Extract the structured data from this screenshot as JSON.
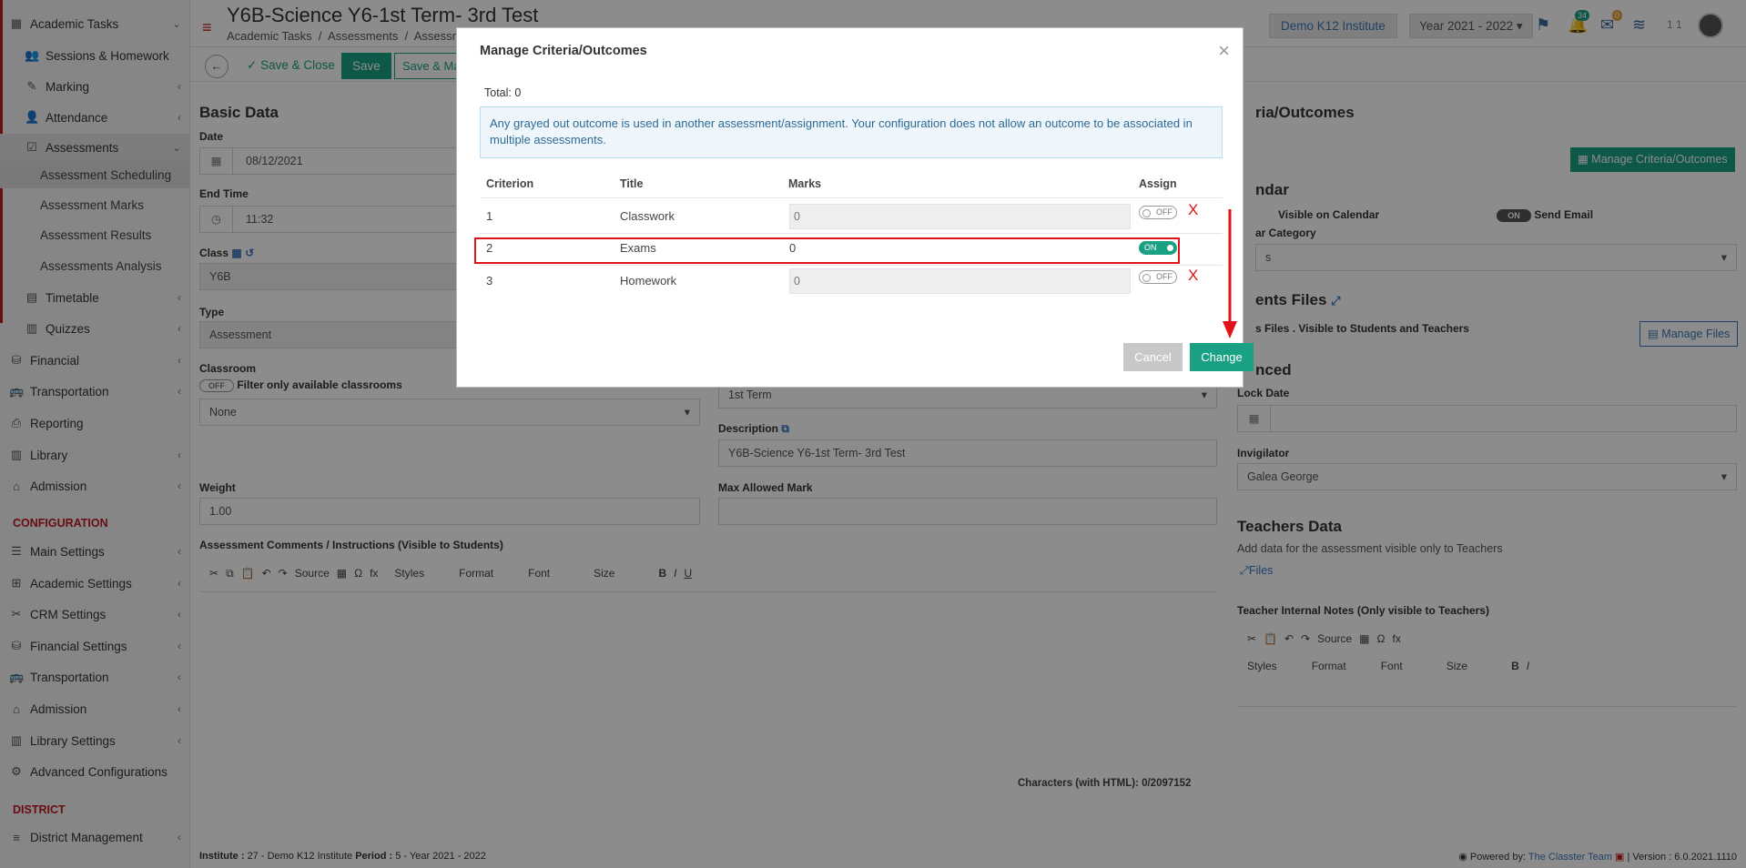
{
  "sidebar": {
    "items": [
      {
        "label": "Academic Tasks"
      },
      {
        "label": "Sessions & Homework"
      },
      {
        "label": "Marking"
      },
      {
        "label": "Attendance"
      },
      {
        "label": "Assessments"
      },
      {
        "label": "Assessment Scheduling"
      },
      {
        "label": "Assessment Marks"
      },
      {
        "label": "Assessment Results"
      },
      {
        "label": "Assessments Analysis"
      },
      {
        "label": "Timetable"
      },
      {
        "label": "Quizzes"
      },
      {
        "label": "Financial"
      },
      {
        "label": "Transportation"
      },
      {
        "label": "Reporting"
      },
      {
        "label": "Library"
      },
      {
        "label": "Admission"
      },
      {
        "label": "Main Settings"
      },
      {
        "label": "Academic Settings"
      },
      {
        "label": "CRM Settings"
      },
      {
        "label": "Financial Settings"
      },
      {
        "label": "Transportation"
      },
      {
        "label": "Admission"
      },
      {
        "label": "Library Settings"
      },
      {
        "label": "Advanced Configurations"
      },
      {
        "label": "District Management"
      }
    ],
    "config_heading": "CONFIGURATION",
    "district_heading": "DISTRICT"
  },
  "header": {
    "title": "Y6B-Science Y6-1st Term- 3rd Test",
    "breadcrumb": [
      "Academic Tasks",
      "Assessments",
      "Assessm"
    ],
    "institute": "Demo K12 Institute",
    "year": "Year 2021 - 2022",
    "notif_count": "34",
    "mail_count": "0",
    "user_short": "1 1"
  },
  "toolbar": {
    "save_close": "Save & Close",
    "save": "Save",
    "save_more": "Save & Ma"
  },
  "form": {
    "basic_data": "Basic Data",
    "date_label": "Date",
    "date_value": "08/12/2021",
    "end_time_label": "End Time",
    "end_time_value": "11:32",
    "class_label": "Class",
    "class_value": "Y6B",
    "type_label": "Type",
    "type_value": "Assessment",
    "classroom_label": "Classroom",
    "filter_label": "Filter only available classrooms",
    "toggle_off": "OFF",
    "classroom_value": "None",
    "term_value": "1st Term",
    "description_label": "Description",
    "description_value": "Y6B-Science Y6-1st Term- 3rd Test",
    "weight_label": "Weight",
    "weight_value": "1.00",
    "max_mark_label": "Max Allowed Mark",
    "comments_label": "Assessment Comments / Instructions (Visible to Students)",
    "editor_items": [
      "Source",
      "Styles",
      "Format",
      "Font",
      "Size"
    ],
    "characters": "Characters (with HTML): 0/2097152"
  },
  "right": {
    "criteria_title": "ria/Outcomes",
    "manage_criteria_btn": "Manage Criteria/Outcomes",
    "calendar_title": "ndar",
    "visible_calendar": "Visible on Calendar",
    "toggle_on": "ON",
    "send_email": "Send Email",
    "category_label": "ar Category",
    "category_value": "s",
    "files_title": "ents Files",
    "files_desc": "s Files . Visible to Students and Teachers",
    "manage_files_btn": "Manage Files",
    "advanced_title": "nced",
    "lock_date_label": "Lock Date",
    "invigilator_label": "Invigilator",
    "invigilator_value": "Galea George",
    "teachers_data_title": "Teachers Data",
    "teachers_data_desc": "Add data for the assessment visible only to Teachers",
    "files_link": "Files",
    "internal_notes_label": "Teacher Internal Notes (Only visible to Teachers)"
  },
  "footer": {
    "left_label1": "Institute :",
    "left_val1": "27 - Demo K12 Institute",
    "left_label2": "Period :",
    "left_val2": "5 - Year 2021 - 2022",
    "powered": "Powered by:",
    "team": "The Classter Team",
    "version": "| Version : 6.0.2021.1110"
  },
  "modal": {
    "title": "Manage Criteria/Outcomes",
    "total": "Total: 0",
    "alert": "Any grayed out outcome is used in another assessment/assignment. Your configuration does not allow an outcome to be associated in multiple assessments.",
    "headers": [
      "Criterion",
      "Title",
      "Marks",
      "Assign"
    ],
    "rows": [
      {
        "criterion": "1",
        "title": "Classwork",
        "marks": "0",
        "assign": "OFF"
      },
      {
        "criterion": "2",
        "title": "Exams",
        "marks": "0",
        "assign": "ON"
      },
      {
        "criterion": "3",
        "title": "Homework",
        "marks": "0",
        "assign": "OFF"
      }
    ],
    "x_mark": "X",
    "cancel": "Cancel",
    "change": "Change"
  },
  "colors": {
    "accent": "#1aa082",
    "brand_red": "#c0191f",
    "annotation_red": "#e0121a",
    "link_blue": "#3a77b8"
  }
}
